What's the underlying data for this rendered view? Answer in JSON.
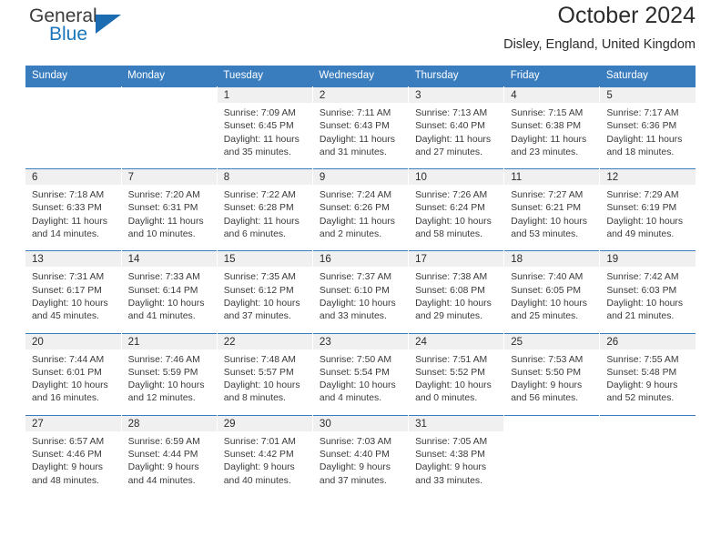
{
  "brand": {
    "name_top": "General",
    "name_bottom": "Blue",
    "color_text": "#3c3c3c",
    "color_accent": "#1b76bb",
    "triangle_icon": "triangle-icon"
  },
  "header": {
    "title": "October 2024",
    "location": "Disley, England, United Kingdom"
  },
  "theme": {
    "header_blue": "#3a7dbf",
    "daynum_band": "#f0f0f0",
    "text": "#3a3a3a"
  },
  "weekdays": [
    "Sunday",
    "Monday",
    "Tuesday",
    "Wednesday",
    "Thursday",
    "Friday",
    "Saturday"
  ],
  "labels": {
    "sunrise": "Sunrise:",
    "sunset": "Sunset:",
    "daylight": "Daylight:"
  },
  "weeks": [
    [
      {
        "day": "",
        "blank": true
      },
      {
        "day": "",
        "blank": true
      },
      {
        "day": "1",
        "sunrise": "Sunrise: 7:09 AM",
        "sunset": "Sunset: 6:45 PM",
        "daylight_1": "Daylight: 11 hours",
        "daylight_2": "and 35 minutes."
      },
      {
        "day": "2",
        "sunrise": "Sunrise: 7:11 AM",
        "sunset": "Sunset: 6:43 PM",
        "daylight_1": "Daylight: 11 hours",
        "daylight_2": "and 31 minutes."
      },
      {
        "day": "3",
        "sunrise": "Sunrise: 7:13 AM",
        "sunset": "Sunset: 6:40 PM",
        "daylight_1": "Daylight: 11 hours",
        "daylight_2": "and 27 minutes."
      },
      {
        "day": "4",
        "sunrise": "Sunrise: 7:15 AM",
        "sunset": "Sunset: 6:38 PM",
        "daylight_1": "Daylight: 11 hours",
        "daylight_2": "and 23 minutes."
      },
      {
        "day": "5",
        "sunrise": "Sunrise: 7:17 AM",
        "sunset": "Sunset: 6:36 PM",
        "daylight_1": "Daylight: 11 hours",
        "daylight_2": "and 18 minutes."
      }
    ],
    [
      {
        "day": "6",
        "sunrise": "Sunrise: 7:18 AM",
        "sunset": "Sunset: 6:33 PM",
        "daylight_1": "Daylight: 11 hours",
        "daylight_2": "and 14 minutes."
      },
      {
        "day": "7",
        "sunrise": "Sunrise: 7:20 AM",
        "sunset": "Sunset: 6:31 PM",
        "daylight_1": "Daylight: 11 hours",
        "daylight_2": "and 10 minutes."
      },
      {
        "day": "8",
        "sunrise": "Sunrise: 7:22 AM",
        "sunset": "Sunset: 6:28 PM",
        "daylight_1": "Daylight: 11 hours",
        "daylight_2": "and 6 minutes."
      },
      {
        "day": "9",
        "sunrise": "Sunrise: 7:24 AM",
        "sunset": "Sunset: 6:26 PM",
        "daylight_1": "Daylight: 11 hours",
        "daylight_2": "and 2 minutes."
      },
      {
        "day": "10",
        "sunrise": "Sunrise: 7:26 AM",
        "sunset": "Sunset: 6:24 PM",
        "daylight_1": "Daylight: 10 hours",
        "daylight_2": "and 58 minutes."
      },
      {
        "day": "11",
        "sunrise": "Sunrise: 7:27 AM",
        "sunset": "Sunset: 6:21 PM",
        "daylight_1": "Daylight: 10 hours",
        "daylight_2": "and 53 minutes."
      },
      {
        "day": "12",
        "sunrise": "Sunrise: 7:29 AM",
        "sunset": "Sunset: 6:19 PM",
        "daylight_1": "Daylight: 10 hours",
        "daylight_2": "and 49 minutes."
      }
    ],
    [
      {
        "day": "13",
        "sunrise": "Sunrise: 7:31 AM",
        "sunset": "Sunset: 6:17 PM",
        "daylight_1": "Daylight: 10 hours",
        "daylight_2": "and 45 minutes."
      },
      {
        "day": "14",
        "sunrise": "Sunrise: 7:33 AM",
        "sunset": "Sunset: 6:14 PM",
        "daylight_1": "Daylight: 10 hours",
        "daylight_2": "and 41 minutes."
      },
      {
        "day": "15",
        "sunrise": "Sunrise: 7:35 AM",
        "sunset": "Sunset: 6:12 PM",
        "daylight_1": "Daylight: 10 hours",
        "daylight_2": "and 37 minutes."
      },
      {
        "day": "16",
        "sunrise": "Sunrise: 7:37 AM",
        "sunset": "Sunset: 6:10 PM",
        "daylight_1": "Daylight: 10 hours",
        "daylight_2": "and 33 minutes."
      },
      {
        "day": "17",
        "sunrise": "Sunrise: 7:38 AM",
        "sunset": "Sunset: 6:08 PM",
        "daylight_1": "Daylight: 10 hours",
        "daylight_2": "and 29 minutes."
      },
      {
        "day": "18",
        "sunrise": "Sunrise: 7:40 AM",
        "sunset": "Sunset: 6:05 PM",
        "daylight_1": "Daylight: 10 hours",
        "daylight_2": "and 25 minutes."
      },
      {
        "day": "19",
        "sunrise": "Sunrise: 7:42 AM",
        "sunset": "Sunset: 6:03 PM",
        "daylight_1": "Daylight: 10 hours",
        "daylight_2": "and 21 minutes."
      }
    ],
    [
      {
        "day": "20",
        "sunrise": "Sunrise: 7:44 AM",
        "sunset": "Sunset: 6:01 PM",
        "daylight_1": "Daylight: 10 hours",
        "daylight_2": "and 16 minutes."
      },
      {
        "day": "21",
        "sunrise": "Sunrise: 7:46 AM",
        "sunset": "Sunset: 5:59 PM",
        "daylight_1": "Daylight: 10 hours",
        "daylight_2": "and 12 minutes."
      },
      {
        "day": "22",
        "sunrise": "Sunrise: 7:48 AM",
        "sunset": "Sunset: 5:57 PM",
        "daylight_1": "Daylight: 10 hours",
        "daylight_2": "and 8 minutes."
      },
      {
        "day": "23",
        "sunrise": "Sunrise: 7:50 AM",
        "sunset": "Sunset: 5:54 PM",
        "daylight_1": "Daylight: 10 hours",
        "daylight_2": "and 4 minutes."
      },
      {
        "day": "24",
        "sunrise": "Sunrise: 7:51 AM",
        "sunset": "Sunset: 5:52 PM",
        "daylight_1": "Daylight: 10 hours",
        "daylight_2": "and 0 minutes."
      },
      {
        "day": "25",
        "sunrise": "Sunrise: 7:53 AM",
        "sunset": "Sunset: 5:50 PM",
        "daylight_1": "Daylight: 9 hours",
        "daylight_2": "and 56 minutes."
      },
      {
        "day": "26",
        "sunrise": "Sunrise: 7:55 AM",
        "sunset": "Sunset: 5:48 PM",
        "daylight_1": "Daylight: 9 hours",
        "daylight_2": "and 52 minutes."
      }
    ],
    [
      {
        "day": "27",
        "sunrise": "Sunrise: 6:57 AM",
        "sunset": "Sunset: 4:46 PM",
        "daylight_1": "Daylight: 9 hours",
        "daylight_2": "and 48 minutes."
      },
      {
        "day": "28",
        "sunrise": "Sunrise: 6:59 AM",
        "sunset": "Sunset: 4:44 PM",
        "daylight_1": "Daylight: 9 hours",
        "daylight_2": "and 44 minutes."
      },
      {
        "day": "29",
        "sunrise": "Sunrise: 7:01 AM",
        "sunset": "Sunset: 4:42 PM",
        "daylight_1": "Daylight: 9 hours",
        "daylight_2": "and 40 minutes."
      },
      {
        "day": "30",
        "sunrise": "Sunrise: 7:03 AM",
        "sunset": "Sunset: 4:40 PM",
        "daylight_1": "Daylight: 9 hours",
        "daylight_2": "and 37 minutes."
      },
      {
        "day": "31",
        "sunrise": "Sunrise: 7:05 AM",
        "sunset": "Sunset: 4:38 PM",
        "daylight_1": "Daylight: 9 hours",
        "daylight_2": "and 33 minutes."
      },
      {
        "day": "",
        "blank": true
      },
      {
        "day": "",
        "blank": true
      }
    ]
  ]
}
